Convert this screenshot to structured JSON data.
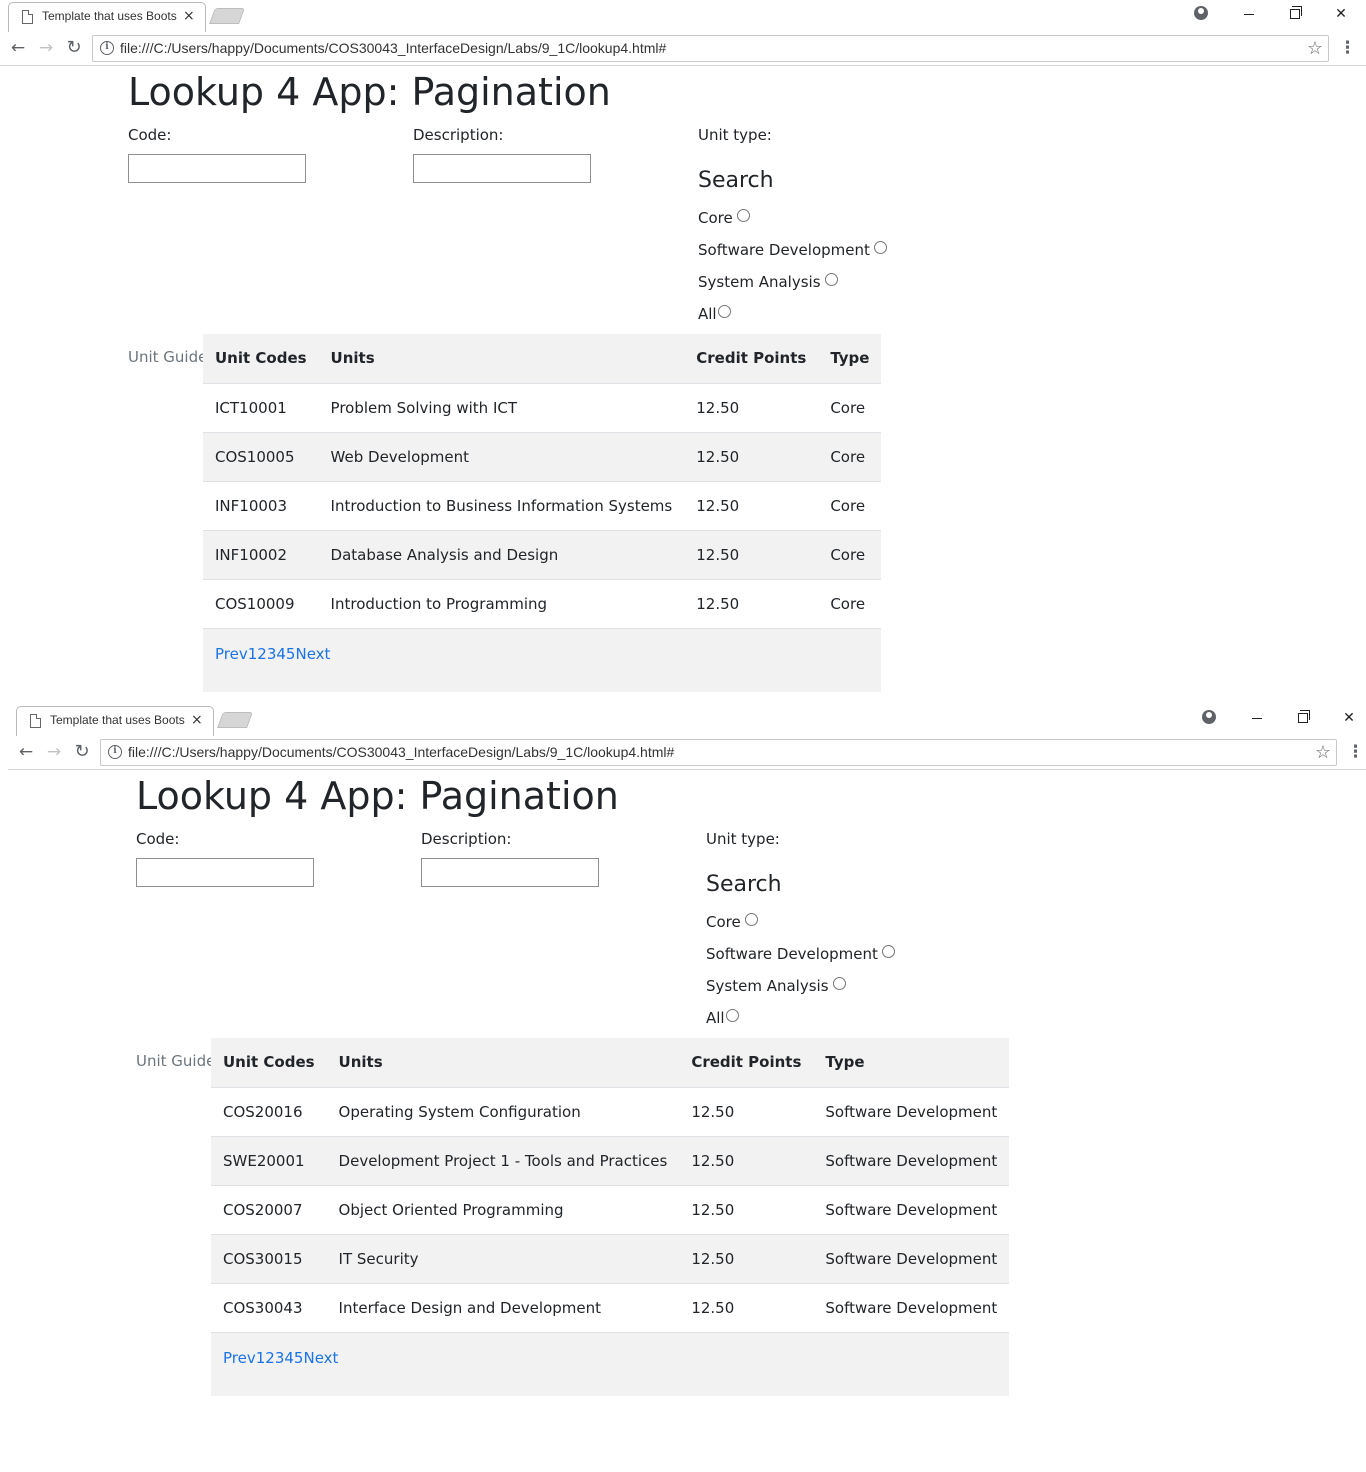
{
  "browser": {
    "tab_title": "Template that uses Bootstrap",
    "tab_close": "×",
    "url": "file:///C:/Users/happy/Documents/COS30043_InterfaceDesign/Labs/9_1C/lookup4.html#",
    "icons": {
      "back": "back-arrow-icon",
      "forward": "forward-arrow-icon",
      "reload": "reload-icon",
      "info": "info-icon",
      "bookmark": "star-icon",
      "menu": "kebab-menu-icon",
      "account": "account-icon",
      "close": "close-icon"
    }
  },
  "page": {
    "title": "Lookup 4 App: Pagination",
    "code_label": "Code:",
    "description_label": "Description:",
    "unit_type_label": "Unit type:",
    "search_heading": "Search",
    "radio_options": [
      "Core",
      "Software Development",
      "System Analysis",
      "All"
    ],
    "table_caption": "Unit Guide",
    "columns": [
      "Unit Codes",
      "Units",
      "Credit Points",
      "Type"
    ],
    "pager": [
      "Prev",
      "1",
      "2",
      "3",
      "4",
      "5",
      "Next"
    ]
  },
  "views": [
    {
      "rows": [
        [
          "ICT10001",
          "Problem Solving with ICT",
          "12.50",
          "Core"
        ],
        [
          "COS10005",
          "Web Development",
          "12.50",
          "Core"
        ],
        [
          "INF10003",
          "Introduction to Business Information Systems",
          "12.50",
          "Core"
        ],
        [
          "INF10002",
          "Database Analysis and Design",
          "12.50",
          "Core"
        ],
        [
          "COS10009",
          "Introduction to Programming",
          "12.50",
          "Core"
        ]
      ]
    },
    {
      "rows": [
        [
          "COS20016",
          "Operating System Configuration",
          "12.50",
          "Software Development"
        ],
        [
          "SWE20001",
          "Development Project 1 - Tools and Practices",
          "12.50",
          "Software Development"
        ],
        [
          "COS20007",
          "Object Oriented Programming",
          "12.50",
          "Software Development"
        ],
        [
          "COS30015",
          "IT Security",
          "12.50",
          "Software Development"
        ],
        [
          "COS30043",
          "Interface Design and Development",
          "12.50",
          "Software Development"
        ]
      ]
    }
  ],
  "colors": {
    "link": "#1a73e8",
    "stripe": "#f2f2f2",
    "caption": "#6c757d",
    "text": "#212529"
  }
}
